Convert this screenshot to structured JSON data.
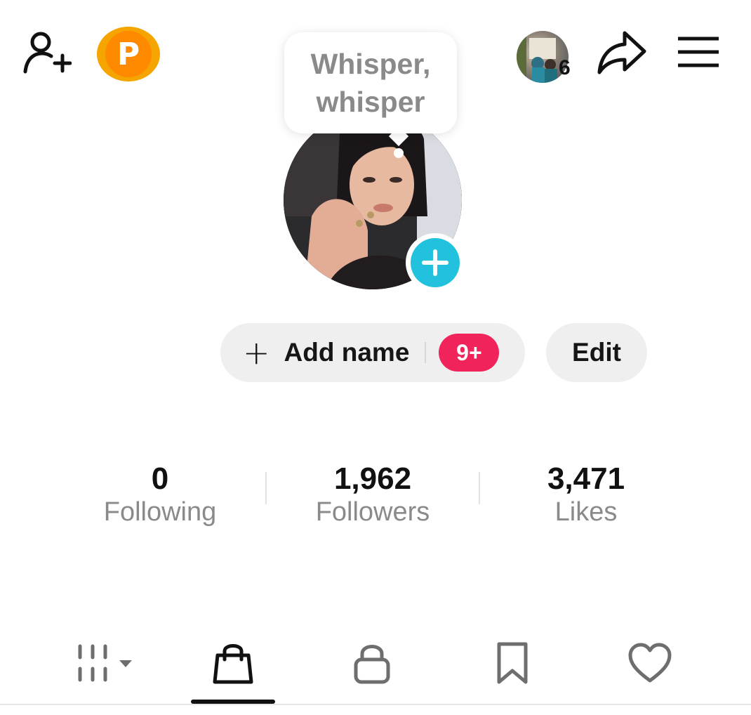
{
  "header": {
    "add_friend_icon": "person-add-icon",
    "points_badge_letter": "P",
    "story_count": "6",
    "share_icon": "share-arrow-icon",
    "menu_icon": "hamburger-menu-icon"
  },
  "tooltip": {
    "text": "Whisper, whisper"
  },
  "profile": {
    "add_photo_icon": "plus-icon",
    "add_name_label": "Add name",
    "add_name_plus": "+",
    "notification_badge": "9+",
    "edit_label": "Edit"
  },
  "stats": [
    {
      "value": "0",
      "label": "Following"
    },
    {
      "value": "1,962",
      "label": "Followers"
    },
    {
      "value": "3,471",
      "label": "Likes"
    }
  ],
  "tabs": [
    {
      "icon": "grid-videos-icon",
      "active": false
    },
    {
      "icon": "shopping-bag-icon",
      "active": true
    },
    {
      "icon": "lock-icon",
      "active": false
    },
    {
      "icon": "bookmark-icon",
      "active": false
    },
    {
      "icon": "heart-icon",
      "active": false
    }
  ],
  "colors": {
    "accent_teal": "#22c2de",
    "badge_red": "#f0245a",
    "points_orange": "#ff8a00",
    "muted_text": "#8a8a8a"
  }
}
